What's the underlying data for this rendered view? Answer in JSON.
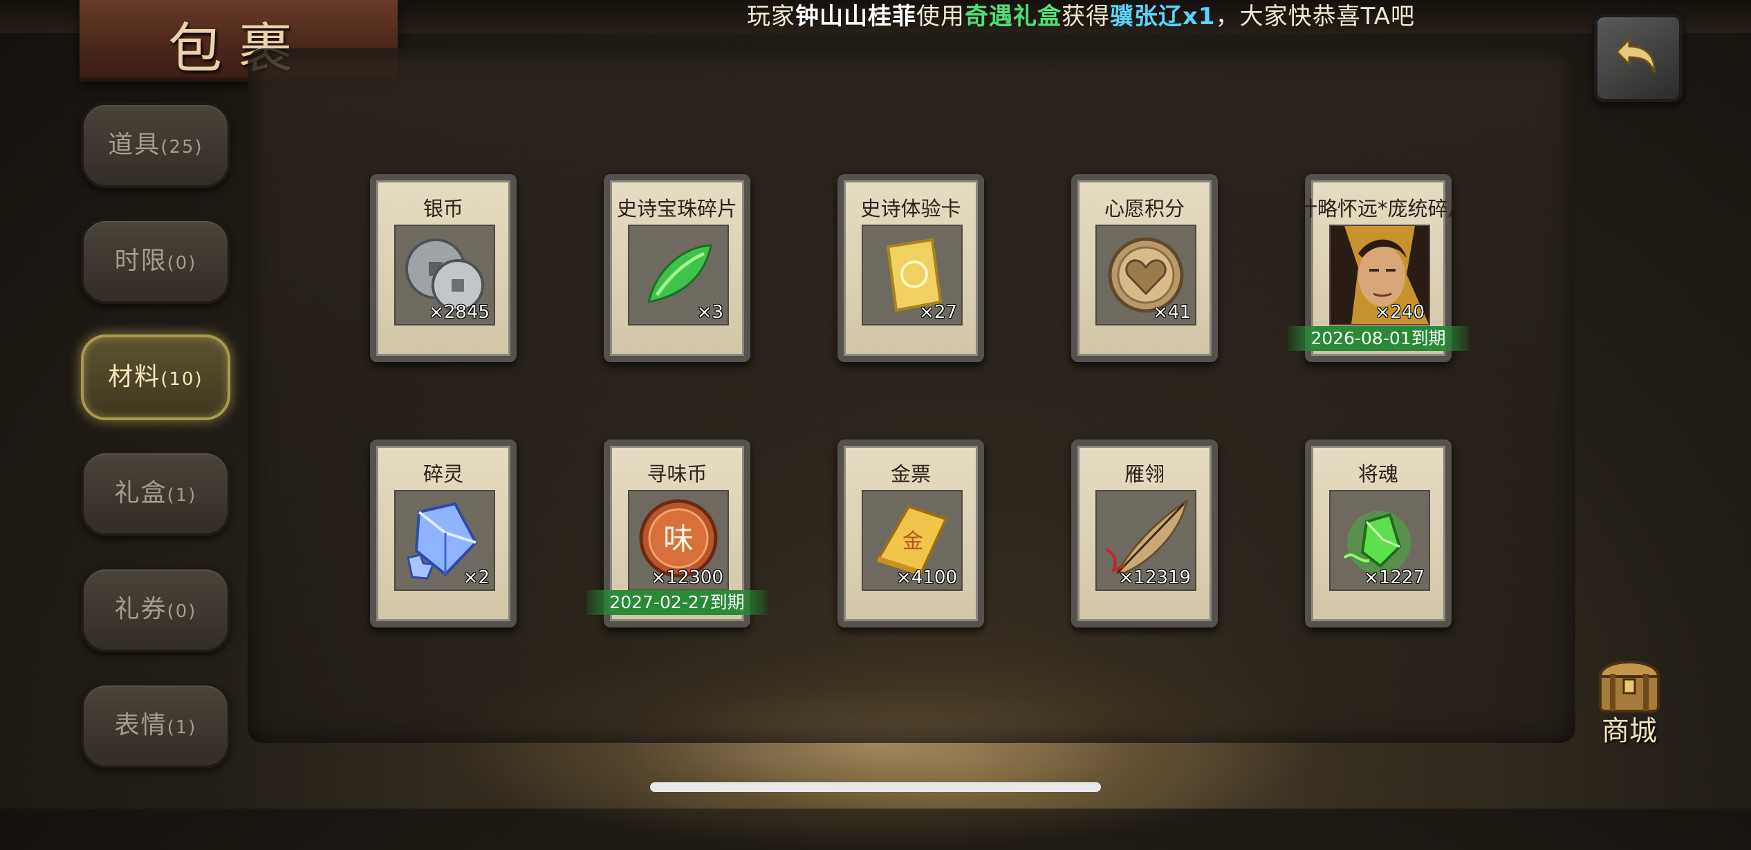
{
  "broadcast": {
    "prefix": "玩家",
    "player": "钟山山桂菲",
    "mid1": "使用",
    "item_used": "奇遇礼盒",
    "mid2": "获得",
    "reward": "骥张辽x1",
    "suffix": "，大家快恭喜TA吧"
  },
  "title": "包裹",
  "tabs": [
    {
      "label": "道具",
      "count": "(25)",
      "active": false
    },
    {
      "label": "时限",
      "count": "(0)",
      "active": false
    },
    {
      "label": "材料",
      "count": "(10)",
      "active": true
    },
    {
      "label": "礼盒",
      "count": "(1)",
      "active": false
    },
    {
      "label": "礼券",
      "count": "(0)",
      "active": false
    },
    {
      "label": "表情",
      "count": "(1)",
      "active": false
    }
  ],
  "items": [
    {
      "name": "银币",
      "count": "×2845",
      "icon": "silver-coin-icon"
    },
    {
      "name": "史诗宝珠碎片",
      "count": "×3",
      "icon": "jade-shard-icon"
    },
    {
      "name": "史诗体验卡",
      "count": "×27",
      "icon": "gold-card-icon"
    },
    {
      "name": "心愿积分",
      "count": "×41",
      "icon": "heart-coin-icon"
    },
    {
      "name": "计略怀远*庞统碎片",
      "count": "×240",
      "icon": "general-portrait-icon",
      "expiry": "2026-08-01到期"
    },
    {
      "name": "碎灵",
      "count": "×2",
      "icon": "crystal-puzzle-icon"
    },
    {
      "name": "寻味币",
      "count": "×12300",
      "icon": "flavor-coin-icon",
      "expiry": "2027-02-27到期",
      "coin_char": "味"
    },
    {
      "name": "金票",
      "count": "×4100",
      "icon": "gold-scroll-icon",
      "scroll_char": "金"
    },
    {
      "name": "雁翎",
      "count": "×12319",
      "icon": "feather-icon"
    },
    {
      "name": "将魂",
      "count": "×1227",
      "icon": "green-soul-icon"
    }
  ],
  "shop": {
    "label": "商城"
  },
  "colors": {
    "accent_green": "#2a8a36",
    "highlight_green": "#4fe07a",
    "highlight_blue": "#5ad4ff"
  }
}
